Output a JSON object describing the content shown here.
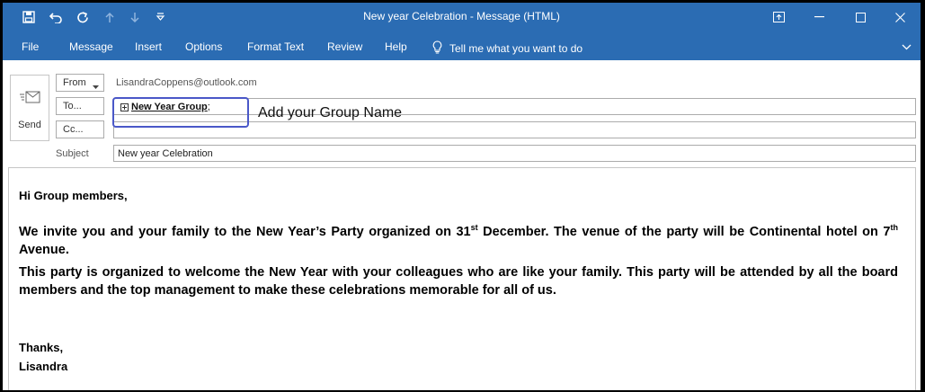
{
  "window": {
    "title": "New year Celebration  -  Message (HTML)"
  },
  "quick_access": [
    "save-icon",
    "undo-icon",
    "redo-icon",
    "up-arrow-icon",
    "down-arrow-icon",
    "customize-icon"
  ],
  "ribbon": {
    "tabs": [
      "File",
      "Message",
      "Insert",
      "Options",
      "Format Text",
      "Review",
      "Help"
    ],
    "tell_me": "Tell me what you want to do"
  },
  "header": {
    "send_label": "Send",
    "from_label": "From",
    "from_address": "LisandraCoppens@outlook.com",
    "to_label": "To...",
    "cc_label": "Cc...",
    "subject_label": "Subject",
    "to_recipient": "New Year Group",
    "to_separator": ";",
    "subject_value": "New year Celebration"
  },
  "annotation": {
    "callout": "Add your Group Name"
  },
  "body": {
    "greeting": "Hi Group members,",
    "p1_a": "We invite you and your family to the New Year’s Party organized on 31",
    "p1_sup1": "st",
    "p1_b": " December. The venue of the party will be Continental hotel on 7",
    "p1_sup2": "th",
    "p1_c": " Avenue.",
    "p2": "This party is organized to welcome the New Year with your colleagues who are like your family. This party will be attended by all the board members and the top management to make these celebrations memorable for all of us.",
    "closing": "Thanks,",
    "signature": "Lisandra"
  },
  "colors": {
    "title_bar": "#2b6cb3",
    "callout_border": "#4a58c8"
  }
}
